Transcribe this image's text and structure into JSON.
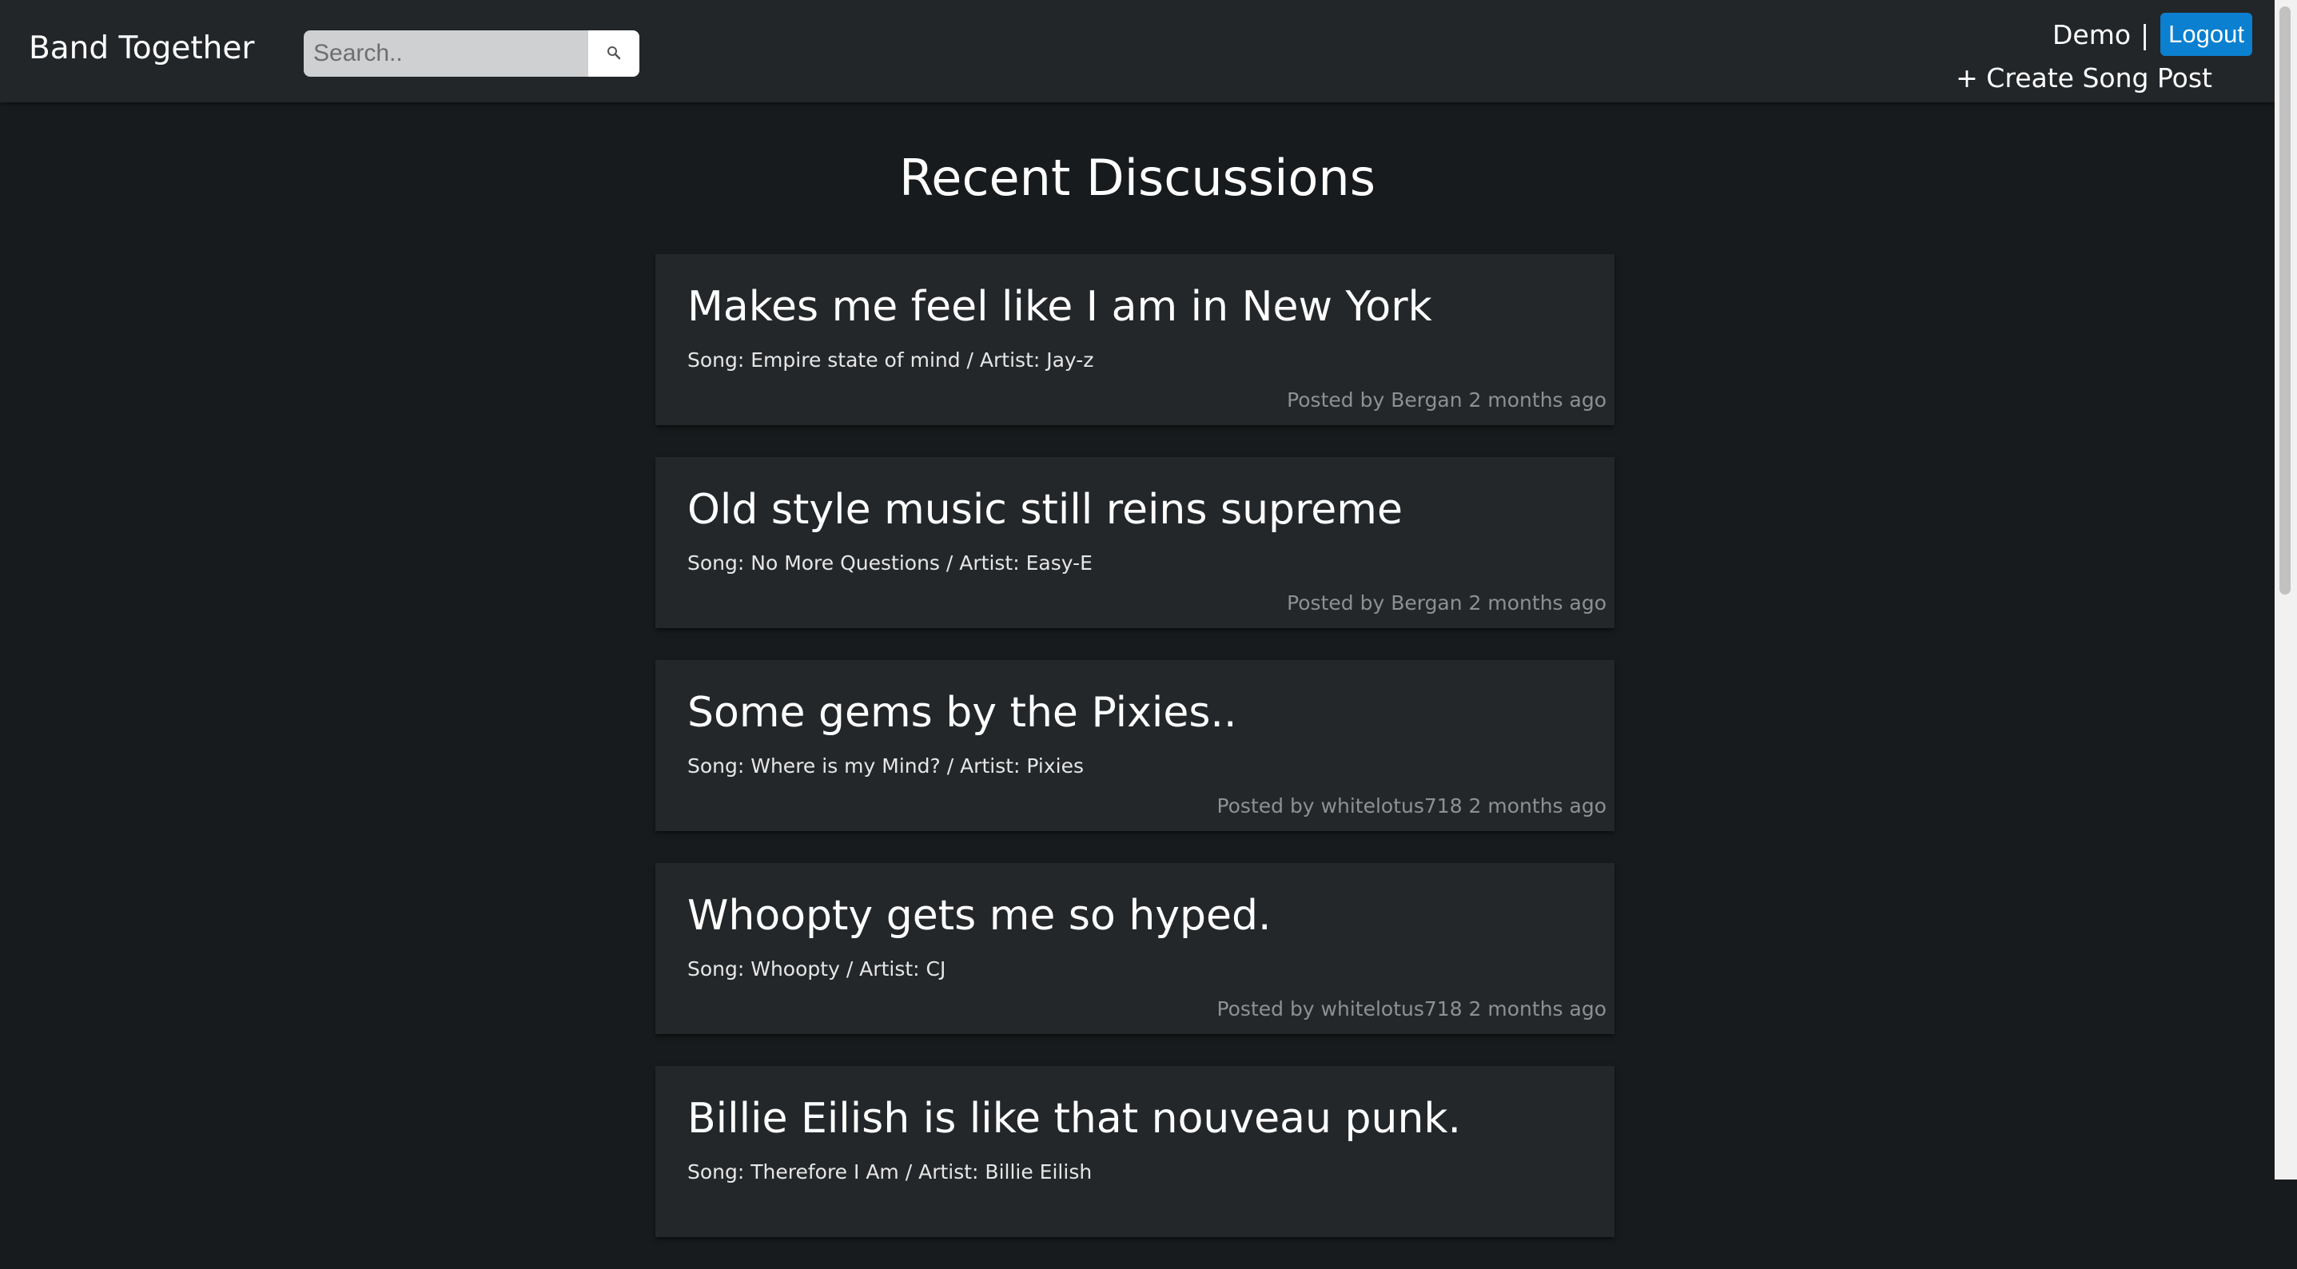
{
  "navbar": {
    "brand": "Band Together",
    "search": {
      "placeholder": "Search..",
      "value": ""
    },
    "search_icon": "search-icon",
    "username": "Demo",
    "separator": "|",
    "logout_label": "Logout",
    "create_label": "+ Create Song Post",
    "accent_color": "#0b7fd0"
  },
  "main": {
    "title": "Recent Discussions",
    "posts": [
      {
        "title": "Makes me feel like I am in New York",
        "meta": "Song: Empire state of mind / Artist: Jay-z",
        "byline": "Posted by Bergan 2 months ago"
      },
      {
        "title": "Old style music still reins supreme",
        "meta": "Song: No More Questions / Artist: Easy-E",
        "byline": "Posted by Bergan 2 months ago"
      },
      {
        "title": "Some gems by the Pixies..",
        "meta": "Song: Where is my Mind? / Artist: Pixies",
        "byline": "Posted by whitelotus718 2 months ago"
      },
      {
        "title": "Whoopty gets me so hyped.",
        "meta": "Song: Whoopty / Artist: CJ",
        "byline": "Posted by whitelotus718 2 months ago"
      },
      {
        "title": "Billie Eilish is like that nouveau punk.",
        "meta": "Song: Therefore I Am / Artist: Billie Eilish",
        "byline": ""
      }
    ]
  }
}
